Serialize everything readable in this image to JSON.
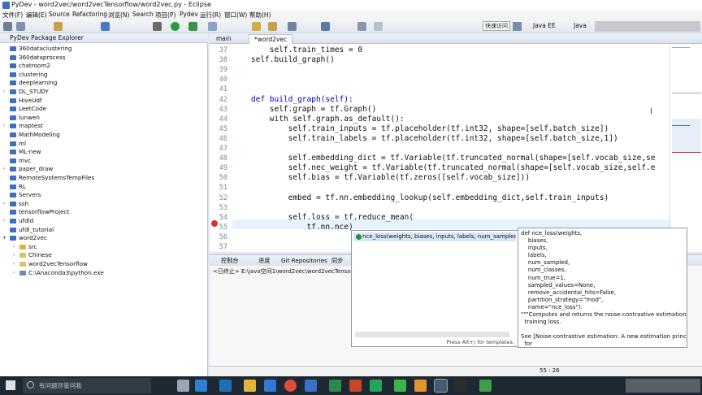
{
  "window": {
    "title": "PyDev - word2vec/word2vecTensorflow/word2vec.py - Eclipse"
  },
  "menu": [
    "文件(F)",
    "编辑(E)",
    "Source",
    "Refactoring",
    "浏览(N)",
    "Search",
    "项目(P)",
    "Pydev",
    "运行(R)",
    "窗口(W)",
    "帮助(H)"
  ],
  "toolbar": {
    "quick_access": "快速访问",
    "perspectives": [
      "Java EE",
      "Java"
    ]
  },
  "explorer": {
    "title": "PyDev Package Explorer",
    "items": [
      "360dataclustering",
      "360dataprocess",
      "chatroom2",
      "clustering",
      "deeplearning",
      "DL_STUDY",
      "HiveUdf",
      "LeetCode",
      "lunwen",
      "maptest",
      "MathModeling",
      "ml",
      "ML-new",
      "mvc",
      "paper_draw",
      "RemoteSystemsTempFiles",
      "RL",
      "Servers",
      "ssh",
      "tensorflowProject",
      "ufdld",
      "ufdl_tutorial",
      "word2vec",
      "src",
      "Chinese",
      "word2vecTensorflow",
      "C:\\Anaconda3\\python.exe"
    ]
  },
  "editor": {
    "tabs": [
      "main",
      "*word2vec"
    ],
    "line_numbers": [
      "37",
      "38",
      "39",
      "40",
      "41",
      "42",
      "43",
      "44",
      "45",
      "46",
      "47",
      "48",
      "49",
      "50",
      "51",
      "52",
      "53",
      "54",
      "55",
      "56",
      "57"
    ],
    "lines": [
      "        self.train_times = 0",
      "    self.build_graph()",
      "",
      "",
      "",
      "    def build_graph(self):",
      "        self.graph = tf.Graph()",
      "        with self.graph.as_default():",
      "            self.train_inputs = tf.placeholder(tf.int32, shape=[self.batch_size])",
      "            self.train_labels = tf.placeholder(tf.int32, shape=[self.batch_size,1])",
      "",
      "            self.embedding_dict = tf.Variable(tf.truncated_normal(shape=[self.vocab_size,se",
      "            self.nec_weight = tf.Variable(tf.truncated_normal(shape=[self.vocab_size,self.e",
      "            self.bias = tf.Variable(tf.zeros([self.vocab_size]))",
      "",
      "            embed = tf.nn.embedding_lookup(self.embedding_dict,self.train_inputs)",
      "",
      "            self.loss = tf.reduce_mean(",
      "                tf.nn.nce)",
      "",
      ""
    ]
  },
  "bottom": {
    "tabs": [
      "控制台",
      "进度",
      "Git Repositories",
      "同步"
    ],
    "console_path": "<已终止> E:\\java空间1\\word2vec\\word2vecTensorflow\\"
  },
  "autocomplete": {
    "item": "nce_loss(weights, biases, inputs, labels, num_sampled, num_c",
    "hint": "Press Alt+/ for templates."
  },
  "doc": "def nce_loss(weights,\n    biases,\n    inputs,\n    labels,\n    num_sampled,\n    num_classes,\n    num_true=1,\n    sampled_values=None,\n    remove_accidental_hits=False,\n    partition_strategy=\"mod\",\n    name=\"nce_loss\"):\n\"\"\"Computes and returns the noise-contrastive estimation\n  training loss.\n\nSee [Noise-contrastive estimation: A new estimation principle\n  for",
  "status": {
    "position": "55 : 26"
  },
  "taskbar": {
    "search_placeholder": "有问题尽管问我"
  }
}
